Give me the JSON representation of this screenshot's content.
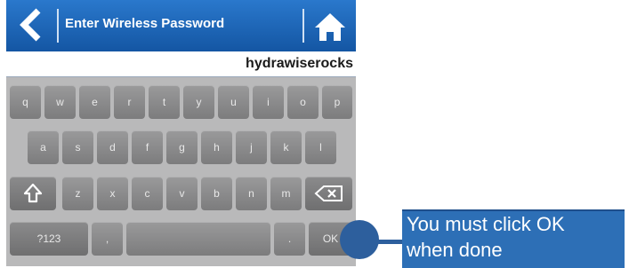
{
  "header": {
    "title": "Enter Wireless Password",
    "back_icon": "back-arrow-icon",
    "home_icon": "home-icon"
  },
  "password_field": {
    "value": "hydrawiserocks"
  },
  "keyboard": {
    "row1": [
      "q",
      "w",
      "e",
      "r",
      "t",
      "y",
      "u",
      "i",
      "o",
      "p"
    ],
    "row2": [
      "a",
      "s",
      "d",
      "f",
      "g",
      "h",
      "j",
      "k",
      "l"
    ],
    "row3_letters": [
      "z",
      "x",
      "c",
      "v",
      "b",
      "n",
      "m"
    ],
    "shift_icon": "shift-icon",
    "backspace_icon": "backspace-icon",
    "numbers_label": "?123",
    "comma_label": ",",
    "period_label": ".",
    "ok_label": "OK"
  },
  "callout": {
    "text_line1": "You must click OK",
    "text_line2": "when done"
  },
  "colors": {
    "header_blue": "#1e63b3",
    "callout_blue": "#2d6fb6",
    "key_gray": "#8a8a8b"
  }
}
